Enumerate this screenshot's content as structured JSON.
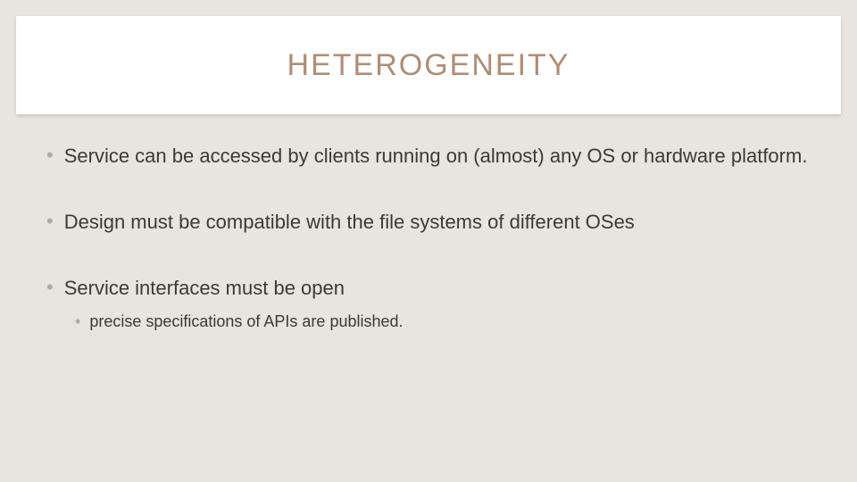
{
  "title": "HETEROGENEITY",
  "bullets": [
    {
      "text": "Service can be accessed by clients running on (almost) any OS or hardware platform."
    },
    {
      "text": "Design must be compatible with the file systems of different OSes"
    },
    {
      "text": "Service interfaces must be open",
      "sub": [
        {
          "text": "precise specifications of APIs are published."
        }
      ]
    }
  ]
}
